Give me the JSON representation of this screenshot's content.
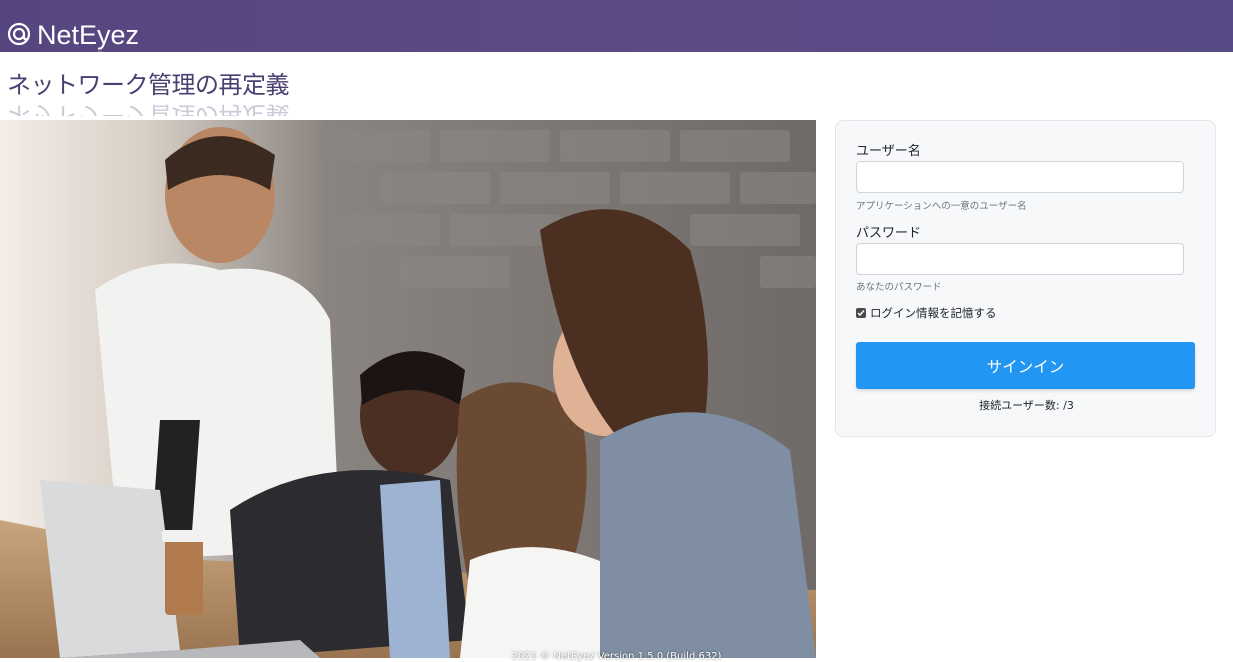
{
  "brand": {
    "name": "NetEyez",
    "logo_icon": "at-swirl-icon"
  },
  "headline": "ネットワーク管理の再定義",
  "hero": {
    "description_icon": "team-photo"
  },
  "login": {
    "username_label": "ユーザー名",
    "username_value": "",
    "username_help": "アプリケーションへの一意のユーザー名",
    "password_label": "パスワード",
    "password_value": "",
    "password_help": "あなたのパスワード",
    "remember_label": "ログイン情報を記憶する",
    "remember_checked": true,
    "signin_label": "サインイン",
    "connected_users": "接続ユーザー数: /3"
  },
  "footer": "2021 © NetEyez Version 1.5.0 (Build 632)",
  "colors": {
    "topbar": "#5a4884",
    "accent": "#2196f3",
    "headline": "#4b3f72"
  }
}
